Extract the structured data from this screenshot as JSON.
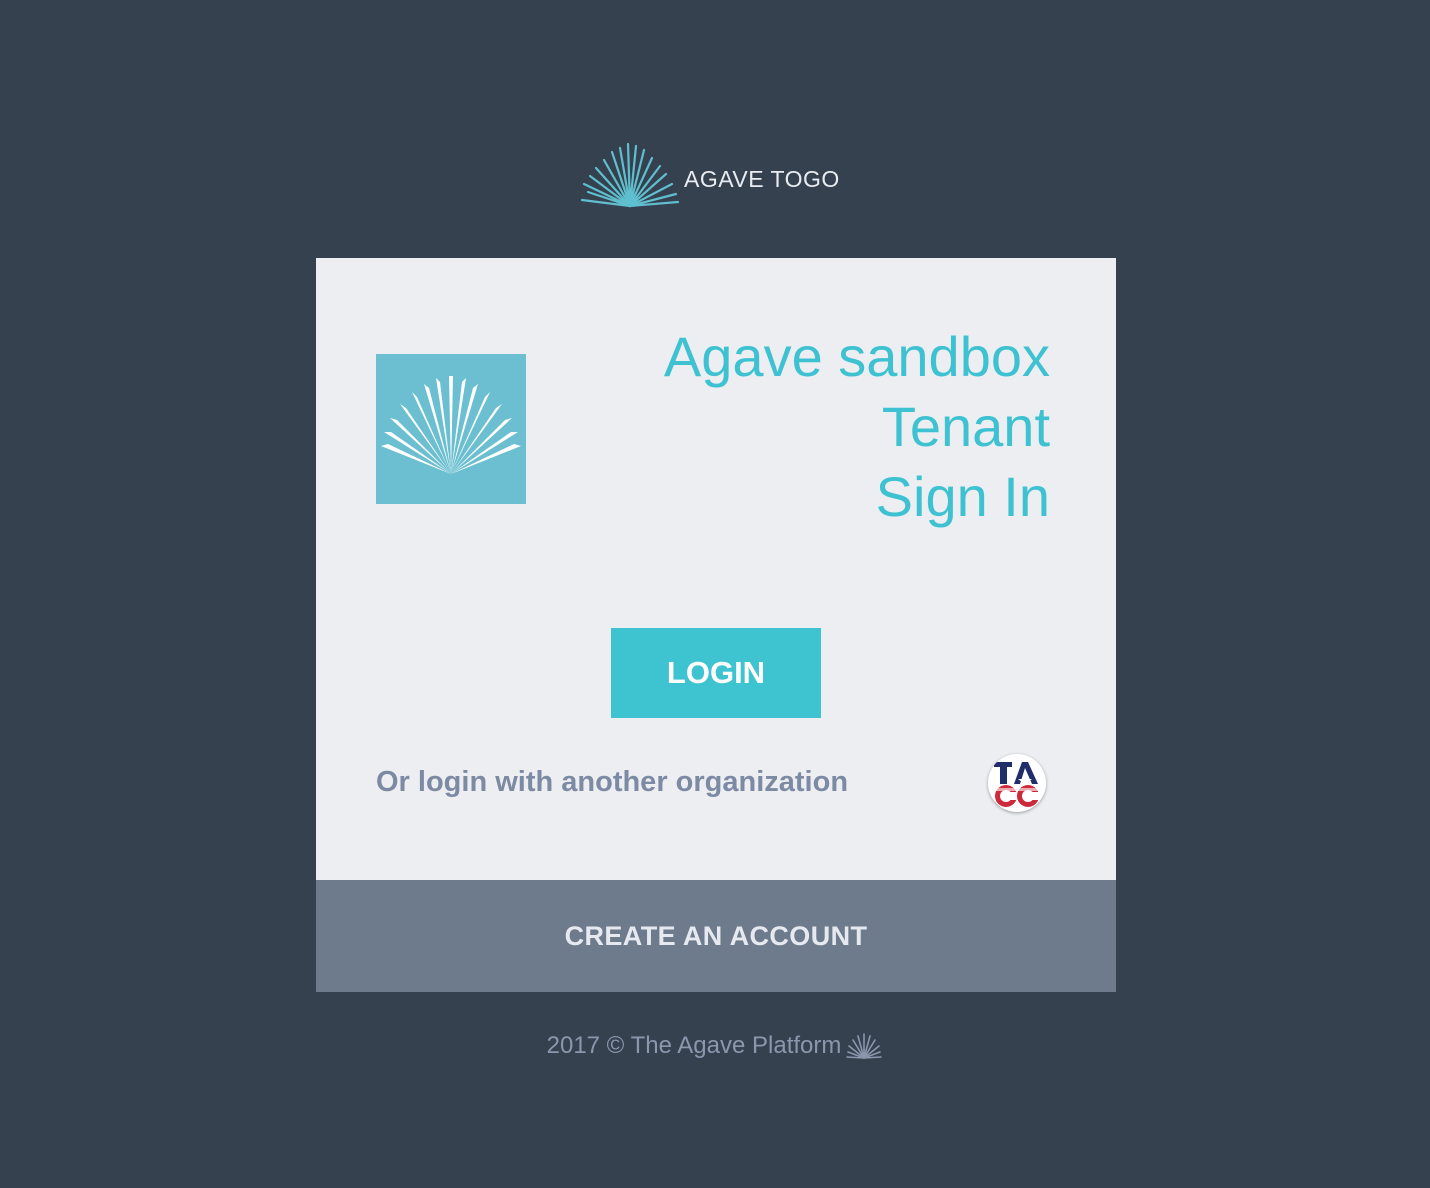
{
  "brand": {
    "name": "AGAVE TOGO",
    "logo_icon": "agave-plant-icon",
    "accent_color": "#3ec2d2"
  },
  "card": {
    "heading_lines": [
      "Agave sandbox",
      "Tenant",
      "Sign In"
    ],
    "tenant_logo_icon": "agave-plant-icon",
    "login_label": "LOGIN",
    "alt_login_text": "Or login with another organization",
    "org_icon": "tacc-logo-icon",
    "create_account_label": "CREATE AN ACCOUNT"
  },
  "footer": {
    "text": "2017 © The Agave Platform",
    "icon": "agave-plant-icon"
  }
}
